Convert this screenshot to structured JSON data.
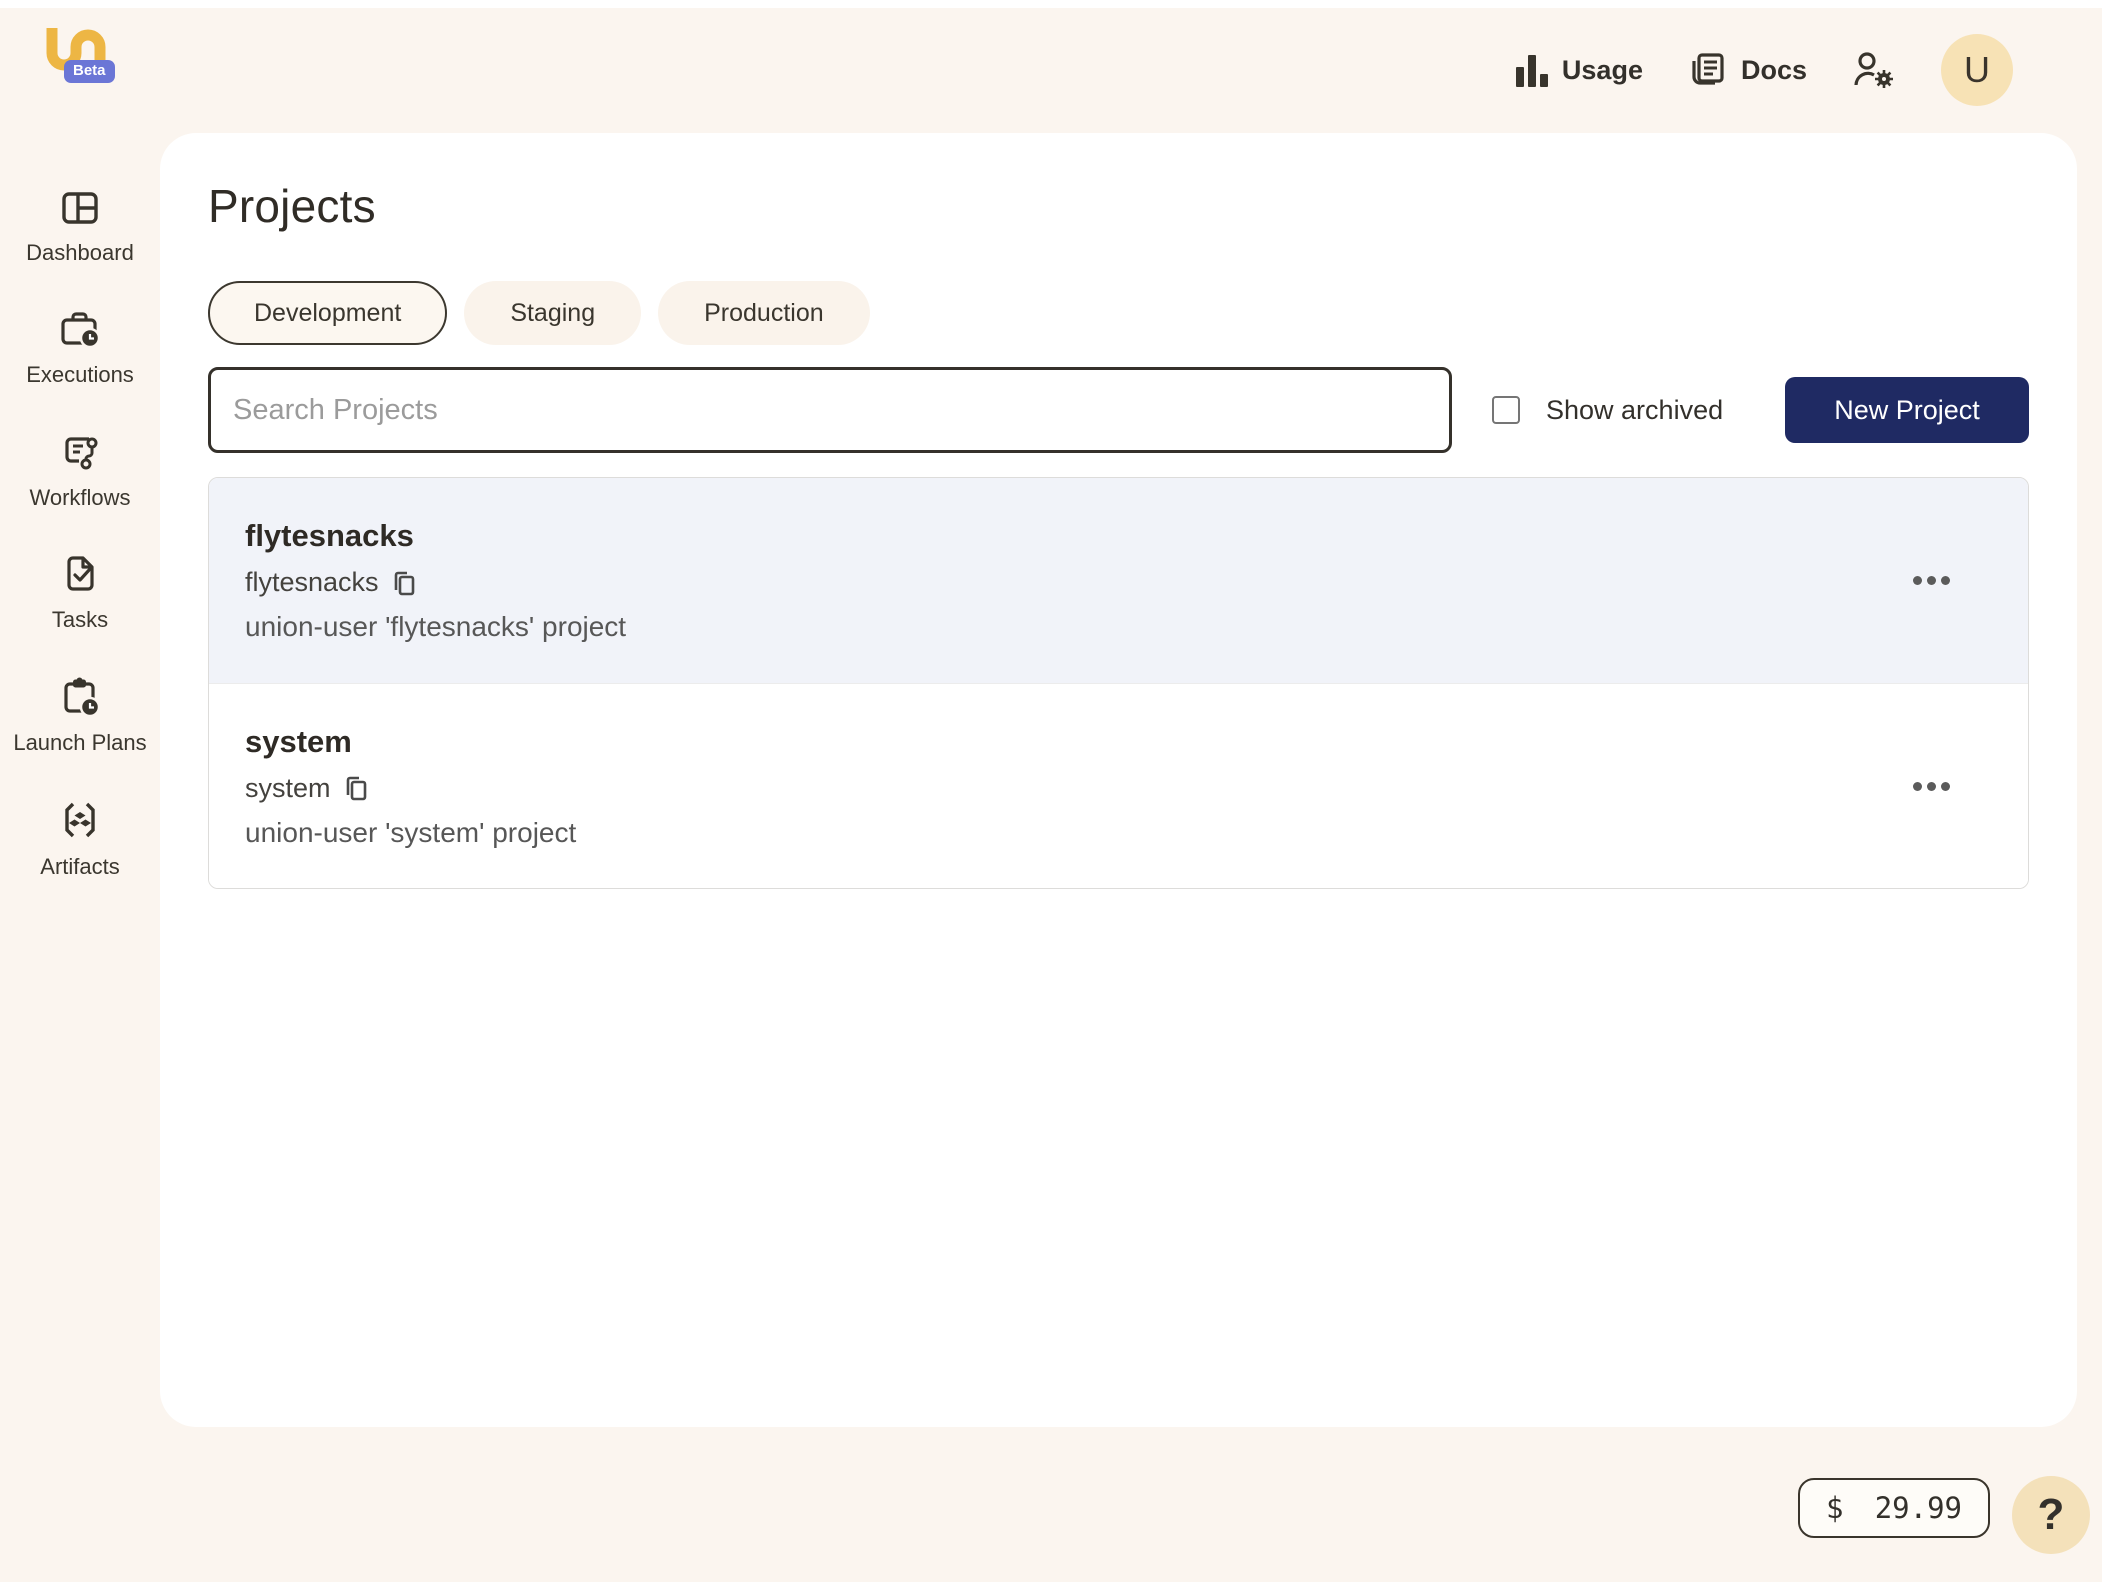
{
  "header": {
    "beta_label": "Beta",
    "usage_label": "Usage",
    "docs_label": "Docs",
    "avatar_initial": "U"
  },
  "sidebar": {
    "items": [
      {
        "label": "Dashboard",
        "icon": "dashboard-icon"
      },
      {
        "label": "Executions",
        "icon": "executions-icon"
      },
      {
        "label": "Workflows",
        "icon": "workflows-icon"
      },
      {
        "label": "Tasks",
        "icon": "tasks-icon"
      },
      {
        "label": "Launch Plans",
        "icon": "launch-plans-icon"
      },
      {
        "label": "Artifacts",
        "icon": "artifacts-icon"
      }
    ]
  },
  "main": {
    "title": "Projects",
    "tabs": [
      {
        "label": "Development",
        "selected": true
      },
      {
        "label": "Staging",
        "selected": false
      },
      {
        "label": "Production",
        "selected": false
      }
    ],
    "search": {
      "placeholder": "Search Projects",
      "value": ""
    },
    "show_archived_label": "Show archived",
    "show_archived_checked": false,
    "new_project_label": "New Project",
    "projects": [
      {
        "title": "flytesnacks",
        "name": "flytesnacks",
        "description": "union-user 'flytesnacks' project",
        "highlighted": true
      },
      {
        "title": "system",
        "name": "system",
        "description": "union-user 'system' project",
        "highlighted": false
      }
    ]
  },
  "footer": {
    "currency_symbol": "$",
    "credits_amount": "29.99",
    "help_label": "?"
  },
  "colors": {
    "page_background": "#FBF5EF",
    "panel_background": "#FFFFFF",
    "brand_gold": "#EDB644",
    "beta_badge": "#6B76D6",
    "primary_button": "#1F2A63",
    "highlighted_row": "#F1F3F9",
    "avatar_background": "#F7E2B5",
    "help_background": "#F4E1BA",
    "dark_text": "#33302B",
    "muted_text": "#575757"
  }
}
